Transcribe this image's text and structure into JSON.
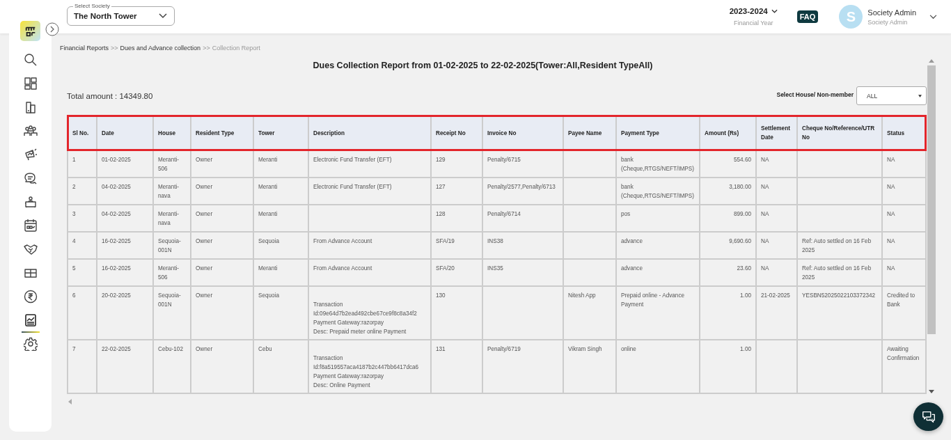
{
  "sidebar": {
    "items": [
      {
        "selected": false
      },
      {
        "selected": false
      },
      {
        "selected": false
      },
      {
        "selected": false
      },
      {
        "selected": false
      },
      {
        "selected": false
      },
      {
        "selected": false
      },
      {
        "selected": false
      },
      {
        "selected": false
      },
      {
        "selected": false
      },
      {
        "selected": true
      },
      {
        "selected": false
      }
    ]
  },
  "header": {
    "society_select": {
      "label": "Select Society",
      "value": "The North Tower"
    },
    "financial_year": {
      "value": "2023-2024",
      "label": "Financial Year"
    },
    "faq": "FAQ",
    "user": {
      "initial": "S",
      "name": "Society Admin",
      "role": "Society Admin"
    }
  },
  "breadcrumb": [
    {
      "label": "Financial Reports",
      "current": false
    },
    {
      "label": ">>",
      "kind": "separator"
    },
    {
      "label": "Dues and Advance collection",
      "current": false
    },
    {
      "label": ">>",
      "kind": "separator"
    },
    {
      "label": "Collection Report",
      "current": true
    }
  ],
  "report": {
    "title": "Dues Collection Report from 01-02-2025 to 22-02-2025(Tower:All,Resident TypeAll)",
    "total": "Total amount : 14349.80",
    "filter": {
      "label": "Select House/ Non-member",
      "value": "ALL"
    },
    "table": {
      "highlighted_header": true,
      "columns": [
        "Sl No.",
        "Date",
        "House",
        "Resident Type",
        "Tower",
        "Description",
        "Receipt No",
        "Invoice No",
        "Payee Name",
        "Payment Type",
        "Amount (Rs)",
        "Settlement Date",
        "Cheque No/Reference/UTR No",
        "Status"
      ],
      "rows": [
        [
          "1",
          "01-02-2025",
          "Meranti-506",
          "Owner",
          "Meranti",
          "Electronic Fund Transfer (EFT)",
          "129",
          "Penalty/6715",
          "",
          "bank (Cheque,RTGS/NEFT/IMPS)",
          "554.60",
          "NA",
          "",
          "NA"
        ],
        [
          "2",
          "04-02-2025",
          "Meranti-nava",
          "Owner",
          "Meranti",
          "Electronic Fund Transfer (EFT)",
          "127",
          "Penalty/2577,Penalty/6713",
          "",
          "bank (Cheque,RTGS/NEFT/IMPS)",
          "3,180.00",
          "NA",
          "",
          "NA"
        ],
        [
          "3",
          "04-02-2025",
          "Meranti-nava",
          "Owner",
          "Meranti",
          "",
          "128",
          "Penalty/6714",
          "",
          "pos",
          "899.00",
          "NA",
          "",
          "NA"
        ],
        [
          "4",
          "16-02-2025",
          "Sequoia-001N",
          "Owner",
          "Sequoia",
          "From Advance Account",
          "SFA/19",
          "INS38",
          "",
          "advance",
          "9,690.60",
          "NA",
          "Ref: Auto settled on 16 Feb 2025",
          "NA"
        ],
        [
          "5",
          "16-02-2025",
          "Meranti-506",
          "Owner",
          "Meranti",
          "From Advance Account",
          "SFA/20",
          "INS35",
          "",
          "advance",
          "23.60",
          "NA",
          "Ref: Auto settled on 16 Feb 2025",
          "NA"
        ],
        [
          "6",
          "20-02-2025",
          "Sequoia-001N",
          "Owner",
          "Sequoia",
          "\nTransaction Id:09e64d7b2ead492cbe67ce9f8c8a34f2\nPayment Gateway:razorpay\nDesc: Prepaid meter online Payment",
          "130",
          "",
          "Nitesh App",
          "Prepaid online - Advance Payment",
          "1.00",
          "21-02-2025",
          "YESBN52025022103372342",
          "Credited to Bank"
        ],
        [
          "7",
          "22-02-2025",
          "Cebu-102",
          "Owner",
          "Cebu",
          "\nTransaction Id:f8a519557aca4187b2c447bb6417dca6\nPayment Gateway:razorpay\nDesc: Online Payment",
          "131",
          "Penalty/6719",
          "Vikram Singh",
          "online",
          "1.00",
          "",
          "",
          "Awaiting Confirmation"
        ]
      ]
    }
  }
}
